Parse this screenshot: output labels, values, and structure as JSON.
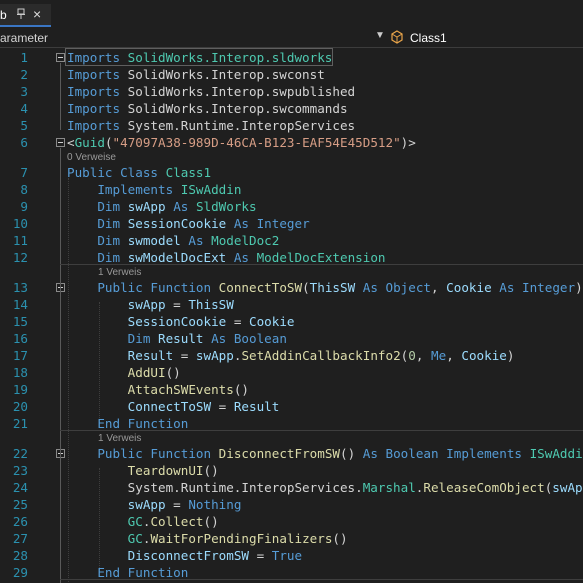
{
  "tab": {
    "title": "b",
    "pin_icon": "pin-icon",
    "close_label": "×"
  },
  "nav": {
    "member_dropdown": "arameter",
    "class_dropdown": "Class1"
  },
  "lines": [
    {
      "num": "1",
      "tokens": [
        [
          "kw",
          "Imports"
        ],
        [
          "tx",
          " "
        ],
        [
          "ty",
          "SolidWorks.Interop.sldworks"
        ]
      ]
    },
    {
      "num": "2",
      "tokens": [
        [
          "kw",
          "Imports"
        ],
        [
          "tx",
          " SolidWorks.Interop.swconst"
        ]
      ]
    },
    {
      "num": "3",
      "tokens": [
        [
          "kw",
          "Imports"
        ],
        [
          "tx",
          " SolidWorks.Interop.swpublished"
        ]
      ]
    },
    {
      "num": "4",
      "tokens": [
        [
          "kw",
          "Imports"
        ],
        [
          "tx",
          " SolidWorks.Interop.swcommands"
        ]
      ]
    },
    {
      "num": "5",
      "tokens": [
        [
          "kw",
          "Imports"
        ],
        [
          "tx",
          " System.Runtime.InteropServices"
        ]
      ]
    },
    {
      "num": "6",
      "tokens": [
        [
          "tx",
          "<"
        ],
        [
          "ty",
          "Guid"
        ],
        [
          "tx",
          "("
        ],
        [
          "st",
          "\"47097A38-989D-46CA-B123-EAF54E45D512\""
        ],
        [
          "tx",
          ")>"
        ]
      ]
    },
    {
      "num": "7",
      "tokens": [
        [
          "kw",
          "Public Class "
        ],
        [
          "ty",
          "Class1"
        ]
      ]
    },
    {
      "num": "8",
      "tokens": [
        [
          "tx",
          "    "
        ],
        [
          "kw",
          "Implements "
        ],
        [
          "ty",
          "ISwAddin"
        ]
      ]
    },
    {
      "num": "9",
      "tokens": [
        [
          "tx",
          "    "
        ],
        [
          "kw",
          "Dim "
        ],
        [
          "id",
          "swApp "
        ],
        [
          "kw",
          "As "
        ],
        [
          "ty",
          "SldWorks"
        ]
      ]
    },
    {
      "num": "10",
      "tokens": [
        [
          "tx",
          "    "
        ],
        [
          "kw",
          "Dim "
        ],
        [
          "id",
          "SessionCookie "
        ],
        [
          "kw",
          "As "
        ],
        [
          "kw",
          "Integer"
        ]
      ]
    },
    {
      "num": "11",
      "tokens": [
        [
          "tx",
          "    "
        ],
        [
          "kw",
          "Dim "
        ],
        [
          "id",
          "swmodel "
        ],
        [
          "kw",
          "As "
        ],
        [
          "ty",
          "ModelDoc2"
        ]
      ]
    },
    {
      "num": "12",
      "tokens": [
        [
          "tx",
          "    "
        ],
        [
          "kw",
          "Dim "
        ],
        [
          "id",
          "swModelDocExt "
        ],
        [
          "kw",
          "As "
        ],
        [
          "ty",
          "ModelDocExtension"
        ]
      ]
    },
    {
      "num": "13",
      "tokens": [
        [
          "tx",
          "    "
        ],
        [
          "kw",
          "Public Function "
        ],
        [
          "fn",
          "ConnectToSW"
        ],
        [
          "tx",
          "("
        ],
        [
          "id",
          "ThisSW "
        ],
        [
          "kw",
          "As "
        ],
        [
          "kw",
          "Object"
        ],
        [
          "tx",
          ", "
        ],
        [
          "id",
          "Cookie "
        ],
        [
          "kw",
          "As "
        ],
        [
          "kw",
          "Integer"
        ],
        [
          "tx",
          ")"
        ]
      ]
    },
    {
      "num": "14",
      "tokens": [
        [
          "tx",
          "        "
        ],
        [
          "id",
          "swApp"
        ],
        [
          "tx",
          " = "
        ],
        [
          "id",
          "ThisSW"
        ]
      ]
    },
    {
      "num": "15",
      "tokens": [
        [
          "tx",
          "        "
        ],
        [
          "id",
          "SessionCookie"
        ],
        [
          "tx",
          " = "
        ],
        [
          "id",
          "Cookie"
        ]
      ]
    },
    {
      "num": "16",
      "tokens": [
        [
          "tx",
          "        "
        ],
        [
          "kw",
          "Dim "
        ],
        [
          "id",
          "Result "
        ],
        [
          "kw",
          "As "
        ],
        [
          "kw",
          "Boolean"
        ]
      ]
    },
    {
      "num": "17",
      "tokens": [
        [
          "tx",
          "        "
        ],
        [
          "id",
          "Result"
        ],
        [
          "tx",
          " = "
        ],
        [
          "id",
          "swApp"
        ],
        [
          "tx",
          "."
        ],
        [
          "fn",
          "SetAddinCallbackInfo2"
        ],
        [
          "tx",
          "("
        ],
        [
          "nu",
          "0"
        ],
        [
          "tx",
          ", "
        ],
        [
          "kw",
          "Me"
        ],
        [
          "tx",
          ", "
        ],
        [
          "id",
          "Cookie"
        ],
        [
          "tx",
          ")"
        ]
      ]
    },
    {
      "num": "18",
      "tokens": [
        [
          "tx",
          "        "
        ],
        [
          "fn",
          "AddUI"
        ],
        [
          "tx",
          "()"
        ]
      ]
    },
    {
      "num": "19",
      "tokens": [
        [
          "tx",
          "        "
        ],
        [
          "fn",
          "AttachSWEvents"
        ],
        [
          "tx",
          "()"
        ]
      ]
    },
    {
      "num": "20",
      "tokens": [
        [
          "tx",
          "        "
        ],
        [
          "id",
          "ConnectToSW"
        ],
        [
          "tx",
          " = "
        ],
        [
          "id",
          "Result"
        ]
      ]
    },
    {
      "num": "21",
      "tokens": [
        [
          "tx",
          "    "
        ],
        [
          "kw",
          "End Function"
        ]
      ]
    },
    {
      "num": "22",
      "tokens": [
        [
          "tx",
          "    "
        ],
        [
          "kw",
          "Public Function "
        ],
        [
          "fn",
          "DisconnectFromSW"
        ],
        [
          "tx",
          "() "
        ],
        [
          "kw",
          "As "
        ],
        [
          "kw",
          "Boolean "
        ],
        [
          "kw",
          "Implements "
        ],
        [
          "ty",
          "ISwAddi"
        ]
      ]
    },
    {
      "num": "23",
      "tokens": [
        [
          "tx",
          "        "
        ],
        [
          "fn",
          "TeardownUI"
        ],
        [
          "tx",
          "()"
        ]
      ]
    },
    {
      "num": "24",
      "tokens": [
        [
          "tx",
          "        System.Runtime.InteropServices."
        ],
        [
          "ty",
          "Marshal"
        ],
        [
          "tx",
          "."
        ],
        [
          "fn",
          "ReleaseComObject"
        ],
        [
          "tx",
          "("
        ],
        [
          "id",
          "swAp"
        ]
      ]
    },
    {
      "num": "25",
      "tokens": [
        [
          "tx",
          "        "
        ],
        [
          "id",
          "swApp"
        ],
        [
          "tx",
          " = "
        ],
        [
          "kw",
          "Nothing"
        ]
      ]
    },
    {
      "num": "26",
      "tokens": [
        [
          "tx",
          "        "
        ],
        [
          "ty",
          "GC"
        ],
        [
          "tx",
          "."
        ],
        [
          "fn",
          "Collect"
        ],
        [
          "tx",
          "()"
        ]
      ]
    },
    {
      "num": "27",
      "tokens": [
        [
          "tx",
          "        "
        ],
        [
          "ty",
          "GC"
        ],
        [
          "tx",
          "."
        ],
        [
          "fn",
          "WaitForPendingFinalizers"
        ],
        [
          "tx",
          "()"
        ]
      ]
    },
    {
      "num": "28",
      "tokens": [
        [
          "tx",
          "        "
        ],
        [
          "id",
          "DisconnectFromSW"
        ],
        [
          "tx",
          " = "
        ],
        [
          "kw",
          "True"
        ]
      ]
    },
    {
      "num": "29",
      "tokens": [
        [
          "tx",
          "    "
        ],
        [
          "kw",
          "End Function"
        ]
      ]
    }
  ],
  "codelens": {
    "class_refs": "0 Verweise",
    "connect_refs": "1 Verweis",
    "disconnect_refs": "1 Verweis"
  }
}
